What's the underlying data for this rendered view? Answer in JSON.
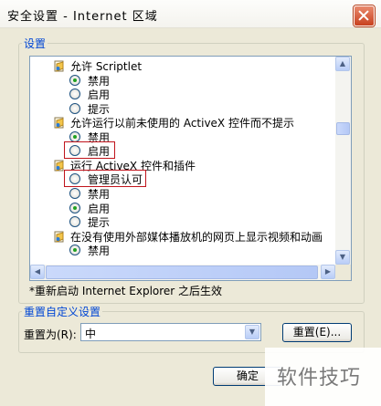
{
  "window": {
    "title": "安全设置 - Internet 区域"
  },
  "settings_group": {
    "label": "设置"
  },
  "settings_list": [
    {
      "type": "category",
      "label": "允许 Scriptlet",
      "icon": "settings-page-icon"
    },
    {
      "type": "option",
      "label": "禁用",
      "selected": true
    },
    {
      "type": "option",
      "label": "启用",
      "selected": false
    },
    {
      "type": "option",
      "label": "提示",
      "selected": false
    },
    {
      "type": "category",
      "label": "允许运行以前未使用的 ActiveX 控件而不提示",
      "icon": "settings-page-icon"
    },
    {
      "type": "option",
      "label": "禁用",
      "selected": true
    },
    {
      "type": "option",
      "label": "启用",
      "selected": false
    },
    {
      "type": "category",
      "label": "运行 ActiveX 控件和插件",
      "icon": "settings-page-icon"
    },
    {
      "type": "option",
      "label": "管理员认可",
      "selected": false
    },
    {
      "type": "option",
      "label": "禁用",
      "selected": false
    },
    {
      "type": "option",
      "label": "启用",
      "selected": true
    },
    {
      "type": "option",
      "label": "提示",
      "selected": false
    },
    {
      "type": "category",
      "label": "在没有使用外部媒体播放机的网页上显示视频和动画",
      "icon": "settings-page-icon"
    },
    {
      "type": "option",
      "label": "禁用",
      "selected": true
    }
  ],
  "restart_note": "*重新启动 Internet Explorer 之后生效",
  "reset_group": {
    "label": "重置自定义设置"
  },
  "reset": {
    "label": "重置为(R):",
    "selected_value": "中",
    "button_label": "重置(E)..."
  },
  "ok_button": {
    "label": "确定"
  },
  "watermark": {
    "text": "软件技巧"
  },
  "colors": {
    "accent": "#0046d5",
    "highlight_box": "#c0141c",
    "radio_selected": "#21a121"
  }
}
